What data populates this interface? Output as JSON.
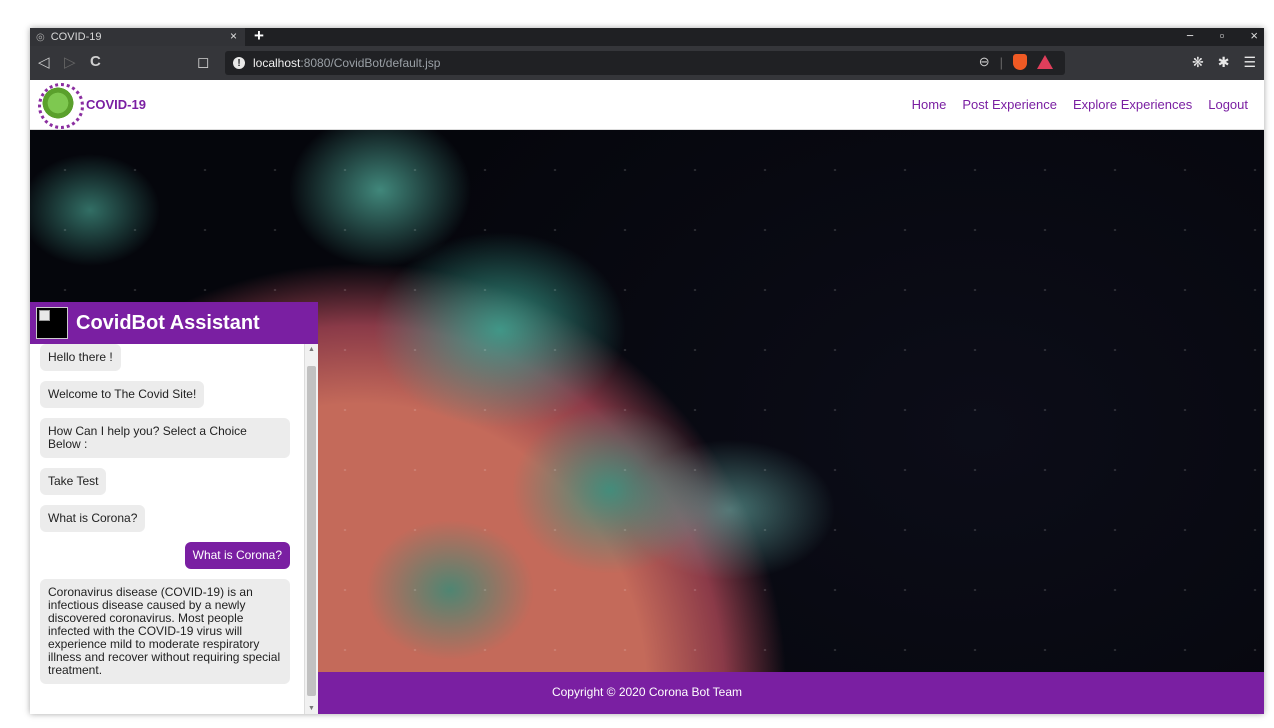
{
  "browser": {
    "tab_title": "COVID-19",
    "tab_close": "×",
    "new_tab": "+",
    "url_host": "localhost",
    "url_rest": ":8080/CovidBot/default.jsp",
    "back_icon": "◁",
    "forward_icon": "▷",
    "reload_icon": "C",
    "bookmark_icon": "◻",
    "zoom_icon": "⊖",
    "minimize": "−",
    "maximize": "▫",
    "close": "×",
    "ext_icons": [
      "❋",
      "✱",
      "☰"
    ]
  },
  "site": {
    "brand": "COVID-19",
    "nav": [
      "Home",
      "Post Experience",
      "Explore Experiences",
      "Logout"
    ]
  },
  "chat": {
    "title": "CovidBot Assistant",
    "messages": [
      {
        "from": "bot",
        "text": "Hello there !"
      },
      {
        "from": "bot",
        "text": "Welcome to The Covid Site!"
      },
      {
        "from": "bot",
        "text": "How Can I help you? Select a Choice Below :"
      },
      {
        "from": "bot",
        "text": "Take Test"
      },
      {
        "from": "bot",
        "text": "What is Corona?"
      },
      {
        "from": "user",
        "text": "What is Corona?"
      },
      {
        "from": "bot",
        "text": "Coronavirus disease (COVID-19) is an infectious disease caused by a newly discovered coronavirus. Most people infected with the COVID-19 virus will experience mild to moderate respiratory illness and recover without requiring special treatment."
      }
    ]
  },
  "footer": {
    "copyright": "Copyright © 2020 Corona Bot Team"
  },
  "colors": {
    "accent": "#7a1fa2",
    "bubble_bg": "#ececec"
  }
}
